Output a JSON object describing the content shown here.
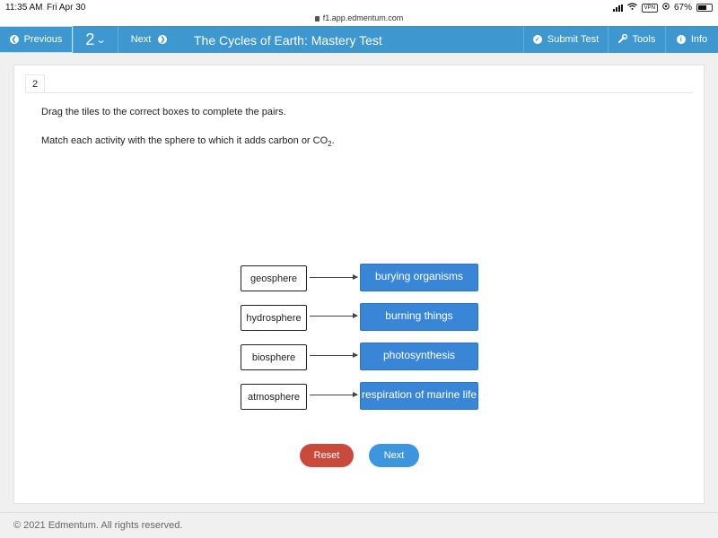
{
  "status_bar": {
    "time": "11:35 AM",
    "date": "Fri Apr 30",
    "url": "f1.app.edmentum.com",
    "vpn": "VPN",
    "battery": "67%",
    "battery_level": 0.67,
    "icons": [
      "signal-icon",
      "wifi-icon",
      "vpn-icon",
      "location-icon",
      "battery-icon"
    ]
  },
  "nav": {
    "previous_label": "Previous",
    "question_number": "2",
    "next_label": "Next",
    "title": "The Cycles of Earth: Mastery Test",
    "submit_label": "Submit Test",
    "tools_label": "Tools",
    "info_label": "Info",
    "bar_color": "#3f97cf"
  },
  "question": {
    "tab_number": "2",
    "instruction": "Drag the tiles to the correct boxes to complete the pairs.",
    "prompt_text": "Match each activity with the sphere to which it adds carbon or CO",
    "prompt_sub": "2",
    "prompt_end": "."
  },
  "pairs": [
    {
      "sphere": "geosphere",
      "tile": "burying organisms"
    },
    {
      "sphere": "hydrosphere",
      "tile": "burning things"
    },
    {
      "sphere": "biosphere",
      "tile": "photosynthesis"
    },
    {
      "sphere": "atmosphere",
      "tile": "respiration of marine life"
    }
  ],
  "actions": {
    "reset_label": "Reset",
    "next_label": "Next",
    "reset_color": "#c94a3c",
    "next_color": "#3d95de"
  },
  "footer": {
    "copyright": "© 2021 Edmentum. All rights reserved."
  }
}
